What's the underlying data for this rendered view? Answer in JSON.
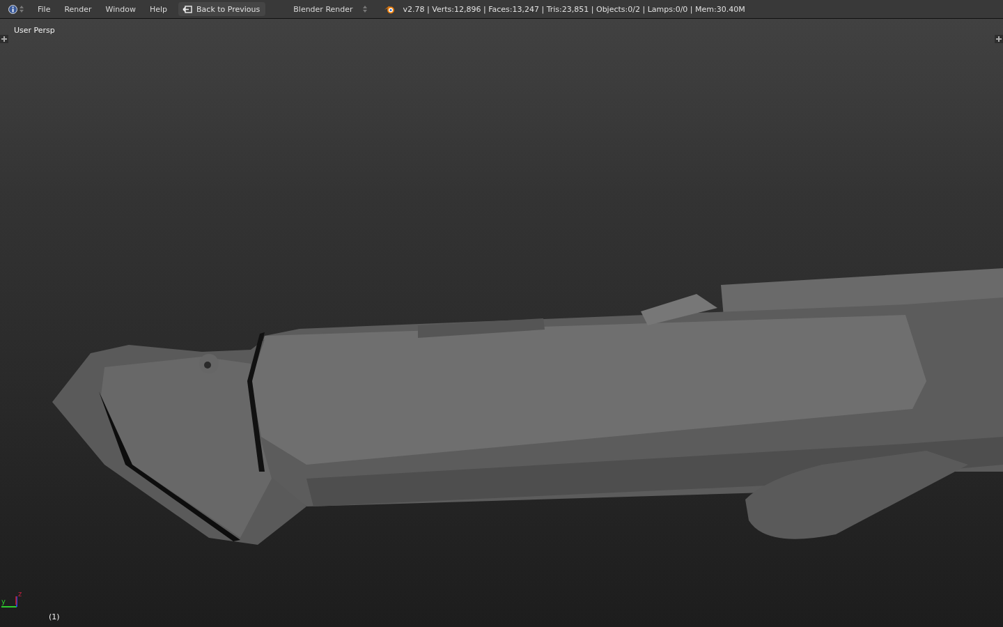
{
  "header": {
    "menus": [
      "File",
      "Render",
      "Window",
      "Help"
    ],
    "back_button": "Back to Previous",
    "engine": "Blender Render",
    "stats": "v2.78 | Verts:12,896 | Faces:13,247 | Tris:23,851 | Objects:0/2 | Lamps:0/0 | Mem:30.40M"
  },
  "viewport": {
    "view_name": "User Persp",
    "frame": "(1)",
    "axes": [
      "y",
      "z"
    ]
  }
}
